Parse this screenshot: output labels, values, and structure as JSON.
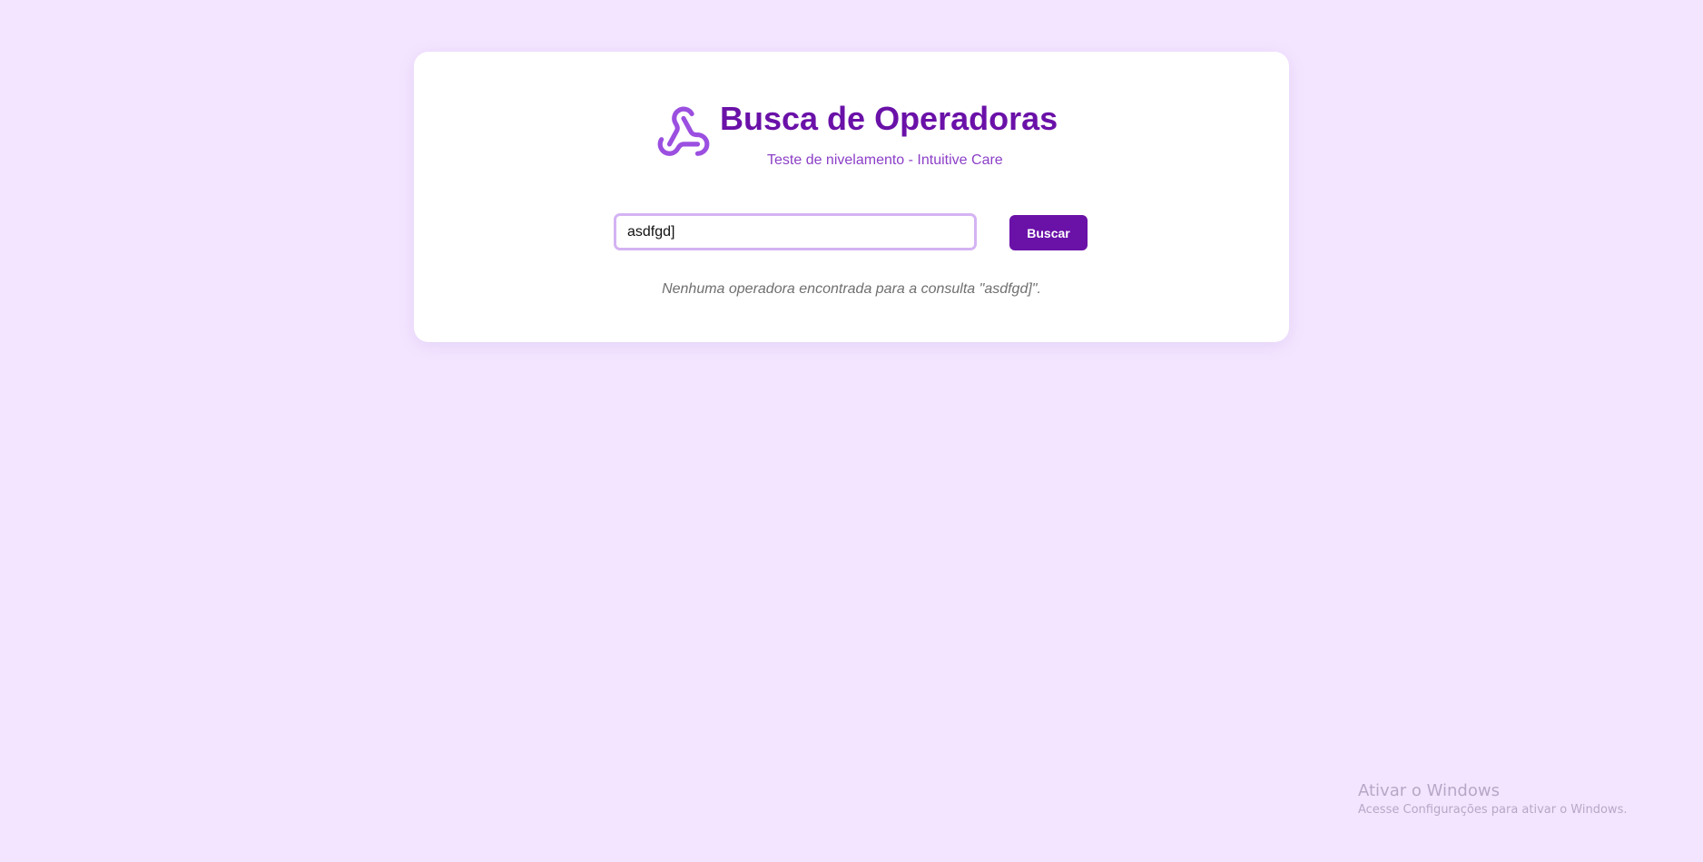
{
  "header": {
    "logo_icon": "webhook-icon",
    "title": "Busca de Operadoras",
    "subtitle": "Teste de nivelamento - Intuitive Care"
  },
  "search": {
    "value": "asdfgd]",
    "placeholder": "",
    "button_label": "Buscar"
  },
  "results": {
    "empty_message": "Nenhuma operadora encontrada para a consulta \"asdfgd]\"."
  },
  "windows_watermark": {
    "title": "Ativar o Windows",
    "subtitle": "Acesse Configurações para ativar o Windows."
  },
  "colors": {
    "background": "#f3e5ff",
    "card": "#ffffff",
    "primary": "#6a11a8",
    "subtitle": "#8c3fc7",
    "input_border": "#d4b3f3",
    "message": "#6f6f6f"
  }
}
